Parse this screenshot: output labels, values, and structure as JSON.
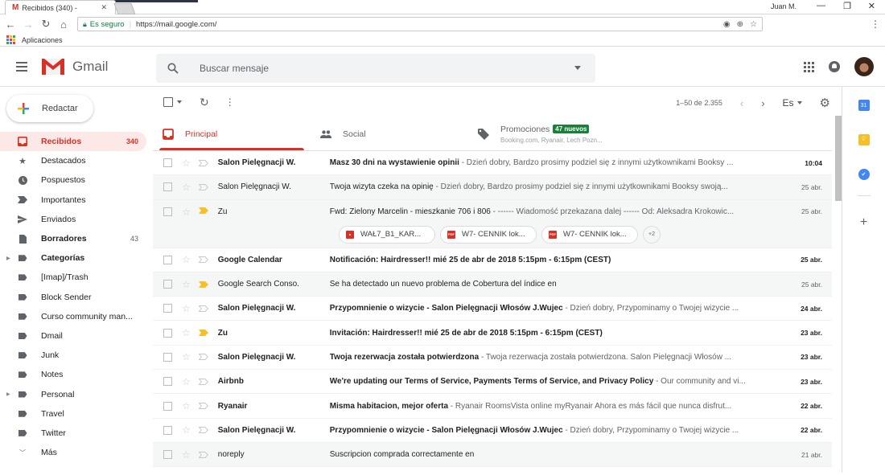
{
  "browser": {
    "tab_title": "Recibidos (340) -",
    "user": "Juan M.",
    "secure_label": "Es seguro",
    "url": "https://mail.google.com/",
    "bookmarks_label": "Aplicaciones"
  },
  "header": {
    "app_name": "Gmail",
    "search_placeholder": "Buscar mensaje"
  },
  "sidebar": {
    "compose_label": "Redactar",
    "items": [
      {
        "label": "Recibidos",
        "count": "340",
        "icon": "inbox-icon"
      },
      {
        "label": "Destacados",
        "count": "",
        "icon": "star-icon"
      },
      {
        "label": "Pospuestos",
        "count": "",
        "icon": "clock-icon"
      },
      {
        "label": "Importantes",
        "count": "",
        "icon": "important-icon"
      },
      {
        "label": "Enviados",
        "count": "",
        "icon": "send-icon"
      },
      {
        "label": "Borradores",
        "count": "43",
        "icon": "draft-icon"
      },
      {
        "label": "Categorías",
        "count": "",
        "icon": "label-icon"
      },
      {
        "label": "[Imap]/Trash",
        "count": "",
        "icon": "label-icon"
      },
      {
        "label": "Block Sender",
        "count": "",
        "icon": "label-icon"
      },
      {
        "label": "Curso community man...",
        "count": "",
        "icon": "label-icon"
      },
      {
        "label": "Dmail",
        "count": "",
        "icon": "label-icon"
      },
      {
        "label": "Junk",
        "count": "",
        "icon": "label-icon"
      },
      {
        "label": "Notes",
        "count": "",
        "icon": "label-icon"
      },
      {
        "label": "Personal",
        "count": "",
        "icon": "label-icon"
      },
      {
        "label": "Travel",
        "count": "",
        "icon": "label-icon"
      },
      {
        "label": "Twitter",
        "count": "",
        "icon": "label-icon"
      },
      {
        "label": "Más",
        "count": "",
        "icon": "chevron-down-icon"
      }
    ]
  },
  "toolbar": {
    "pagination": "1–50 de 2.355",
    "language": "Es"
  },
  "tabs": [
    {
      "label": "Principal",
      "active": true
    },
    {
      "label": "Social",
      "active": false
    },
    {
      "label": "Promociones",
      "badge": "47 nuevos",
      "subtitle": "Booking.com, Ryanair, Lech Pozn...",
      "active": false
    }
  ],
  "emails": [
    {
      "sender": "Salon Pielęgnacji W.",
      "subject": "Masz 30 dni na wystawienie opinii",
      "snippet": " - Dzień dobry, Bardzo prosimy podziel się z innymi użytkownikami Booksy ...",
      "date": "10:04",
      "unread": true,
      "important": false
    },
    {
      "sender": "Salon Pielęgnacji W.",
      "subject": "Twoja wizyta czeka na opinię",
      "snippet": " - Dzień dobry, Bardzo prosimy podziel się z innymi użytkownikami Booksy swoją...",
      "date": "25 abr.",
      "unread": false,
      "important": false
    },
    {
      "sender": "Zu",
      "subject": "Fwd: Zielony Marcelin - mieszkanie 706 i 806",
      "snippet": " - ------ Wiadomość przekazana dalej ------ Od: Aleksadra Krokowic...",
      "date": "25 abr.",
      "unread": false,
      "important": true,
      "attachments": [
        {
          "name": "WAŁ7_B1_KAR...",
          "type": "image"
        },
        {
          "name": "W7- CENNIK lok...",
          "type": "pdf"
        },
        {
          "name": "W7- CENNIK lok...",
          "type": "pdf"
        }
      ],
      "more_attachments": "+2"
    },
    {
      "sender": "Google Calendar",
      "subject": "Notificación: Hairdresser!! mié 25 de abr de 2018 5:15pm - 6:15pm (CEST)",
      "snippet": "",
      "date": "25 abr.",
      "unread": true,
      "important": false
    },
    {
      "sender": "Google Search Conso.",
      "subject": "Se ha detectado un nuevo problema de Cobertura del índice en",
      "snippet": "",
      "date": "25 abr.",
      "unread": false,
      "important": true
    },
    {
      "sender": "Salon Pielęgnacji W.",
      "subject": "Przypomnienie o wizycie - Salon Pielęgnacji Włosów J.Wujec",
      "snippet": " - Dzień dobry, Przypominamy o Twojej wizycie ...",
      "date": "24 abr.",
      "unread": true,
      "important": false
    },
    {
      "sender": "Zu",
      "subject": "Invitación: Hairdresser!! mié 25 de abr de 2018 5:15pm - 6:15pm (CEST)",
      "snippet": "",
      "date": "23 abr.",
      "unread": true,
      "important": true
    },
    {
      "sender": "Salon Pielęgnacji W.",
      "subject": "Twoja rezerwacja została potwierdzona",
      "snippet": " - Twoja rezerwacja została potwierdzona. Salon Pielęgnacji Włosów ...",
      "date": "23 abr.",
      "unread": true,
      "important": false
    },
    {
      "sender": "Airbnb",
      "subject": "We're updating our Terms of Service, Payments Terms of Service, and Privacy Policy",
      "snippet": " - Our community and vi...",
      "date": "23 abr.",
      "unread": true,
      "important": false
    },
    {
      "sender": "Ryanair",
      "subject": "Misma habitacion, mejor oferta",
      "snippet": " - Ryanair RoomsVista online myRyanair Ahora es más fácil que nunca disfrut...",
      "date": "22 abr.",
      "unread": true,
      "important": false
    },
    {
      "sender": "Salon Pielęgnacji W.",
      "subject": "Przypomnienie o wizycie - Salon Pielęgnacji Włosów J.Wujec",
      "snippet": " - Dzień dobry, Przypominamy o Twojej wizycie ...",
      "date": "22 abr.",
      "unread": true,
      "important": false
    },
    {
      "sender": "noreply",
      "subject": "Suscripcion comprada correctamente en",
      "snippet": "",
      "date": "21 abr.",
      "unread": false,
      "important": false
    }
  ],
  "colors": {
    "accent": "#d93025",
    "badge_green": "#188038",
    "important_yellow": "#f6bf26"
  }
}
